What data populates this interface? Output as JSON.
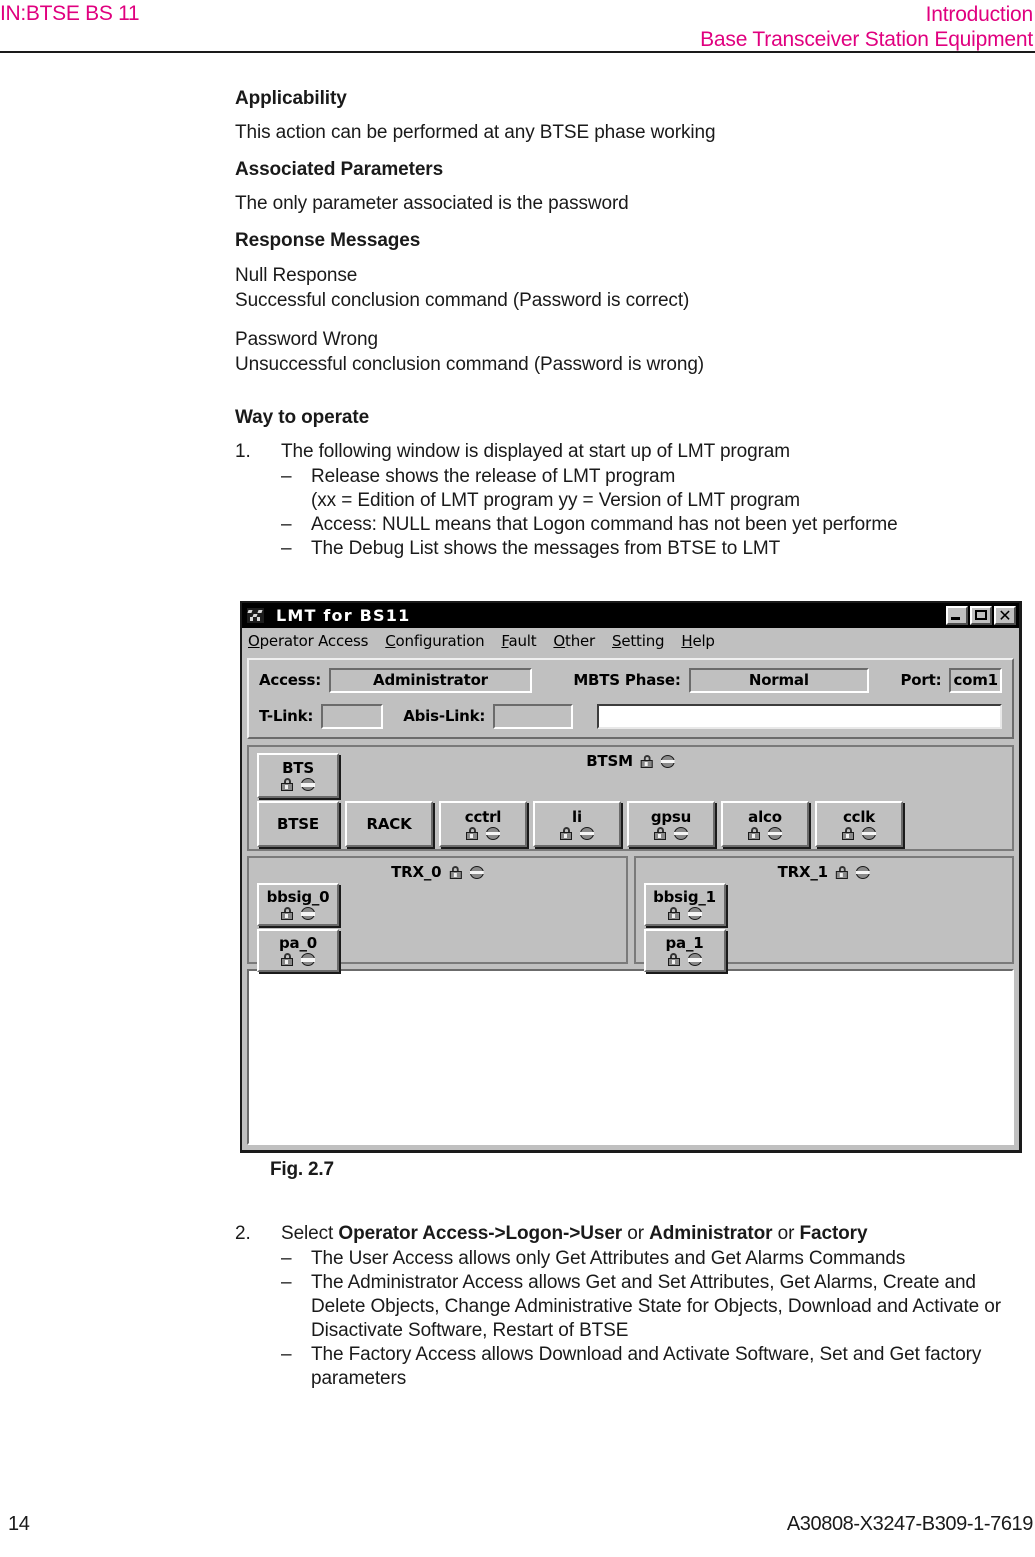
{
  "header": {
    "left": "IN:BTSE BS 11",
    "right_line1": "Introduction",
    "right_line2": "Base Transceiver Station Equipment",
    "accent_color": "#e0007f"
  },
  "sections": {
    "applicability_heading": "Applicability",
    "applicability_text": "This action can be performed at any BTSE phase working",
    "associated_heading": "Associated Parameters",
    "associated_text": "The only parameter associated is the password",
    "response_heading": "Response Messages",
    "response_block1_line1": "Null Response",
    "response_block1_line2": "Successful conclusion command  (Password is correct)",
    "response_block2_line1": "Password Wrong",
    "response_block2_line2": "Unsuccessful conclusion command  (Password is wrong)",
    "way_heading": "Way to operate"
  },
  "steps": {
    "step1_num": "1.",
    "step1_text": "The following window is displayed at start up of  LMT program",
    "step1_bullets": [
      {
        "dash": "–",
        "line1": "Release shows the release of LMT program",
        "line2": "(xx = Edition of LMT program yy = Version of LMT program"
      },
      {
        "dash": "–",
        "line1": "Access: NULL means that Logon command has not been yet performe",
        "line2": ""
      },
      {
        "dash": "–",
        "line1": "The Debug List shows the messages from BTSE to LMT",
        "line2": ""
      }
    ],
    "step2_num": "2.",
    "step2_prefix": "Select ",
    "step2_bold1": "Operator Access->Logon->User",
    "step2_mid1": "  or ",
    "step2_bold2": "Administrator",
    "step2_mid2": " or ",
    "step2_bold3": "Factory",
    "step2_bullets": [
      {
        "dash": "–",
        "text": "The User Access allows only Get Attributes and Get Alarms Commands"
      },
      {
        "dash": "–",
        "text": "The Administrator Access allows Get and Set Attributes, Get Alarms, Create and Delete Objects, Change Administrative State for Objects, Download and Activate or Disactivate Software, Restart of BTSE"
      },
      {
        "dash": "–",
        "text": "The Factory Access allows Download and Activate Software, Set and Get factory parameters"
      }
    ]
  },
  "figure": {
    "caption": "Fig.  2.7"
  },
  "lmt": {
    "title": "LMT  for  BS11",
    "app_icon": "app-logo-icon",
    "window_buttons": [
      {
        "name": "minimize",
        "glyph": "_"
      },
      {
        "name": "maximize",
        "glyph": "□"
      },
      {
        "name": "close",
        "glyph": "✕"
      }
    ],
    "menu": [
      {
        "accel": "O",
        "rest": "perator Access"
      },
      {
        "accel": "C",
        "rest": "onfiguration"
      },
      {
        "accel": "F",
        "rest": "ault"
      },
      {
        "accel": "O",
        "rest": "ther"
      },
      {
        "accel": "S",
        "rest": "etting"
      },
      {
        "accel": "H",
        "rest": "elp"
      }
    ],
    "status": {
      "access_label": "Access:",
      "access_value": "Administrator",
      "phase_label": "MBTS Phase:",
      "phase_value": "Normal",
      "port_label": "Port:",
      "port_value": "com1",
      "tlink_label": "T-Link:",
      "tlink_value": "",
      "abis_label": "Abis-Link:",
      "abis_value": "",
      "message_value": ""
    },
    "btsm": {
      "title": "BTSM",
      "top_node": {
        "label": "BTS",
        "icons": [
          "lock-icon",
          "disabled-icon"
        ]
      },
      "row": [
        {
          "label": "BTSE",
          "icons": []
        },
        {
          "label": "RACK",
          "icons": []
        },
        {
          "label": "cctrl",
          "icons": [
            "lock-icon",
            "disabled-icon"
          ]
        },
        {
          "label": "li",
          "icons": [
            "lock-icon",
            "disabled-icon"
          ]
        },
        {
          "label": "gpsu",
          "icons": [
            "lock-icon",
            "disabled-icon"
          ]
        },
        {
          "label": "alco",
          "icons": [
            "lock-icon",
            "disabled-icon"
          ]
        },
        {
          "label": "cclk",
          "icons": [
            "lock-icon",
            "disabled-icon"
          ]
        }
      ]
    },
    "trx": [
      {
        "title": "TRX_0",
        "nodes": [
          {
            "label": "bbsig_0",
            "icons": [
              "lock-icon",
              "disabled-icon"
            ]
          },
          {
            "label": "pa_0",
            "icons": [
              "lock-icon",
              "disabled-icon"
            ]
          }
        ]
      },
      {
        "title": "TRX_1",
        "nodes": [
          {
            "label": "bbsig_1",
            "icons": [
              "lock-icon",
              "disabled-icon"
            ]
          },
          {
            "label": "pa_1",
            "icons": [
              "lock-icon",
              "disabled-icon"
            ]
          }
        ]
      }
    ],
    "debug_list_content": ""
  },
  "footer": {
    "page": "14",
    "document_number": "A30808-X3247-B309-1-7619"
  }
}
